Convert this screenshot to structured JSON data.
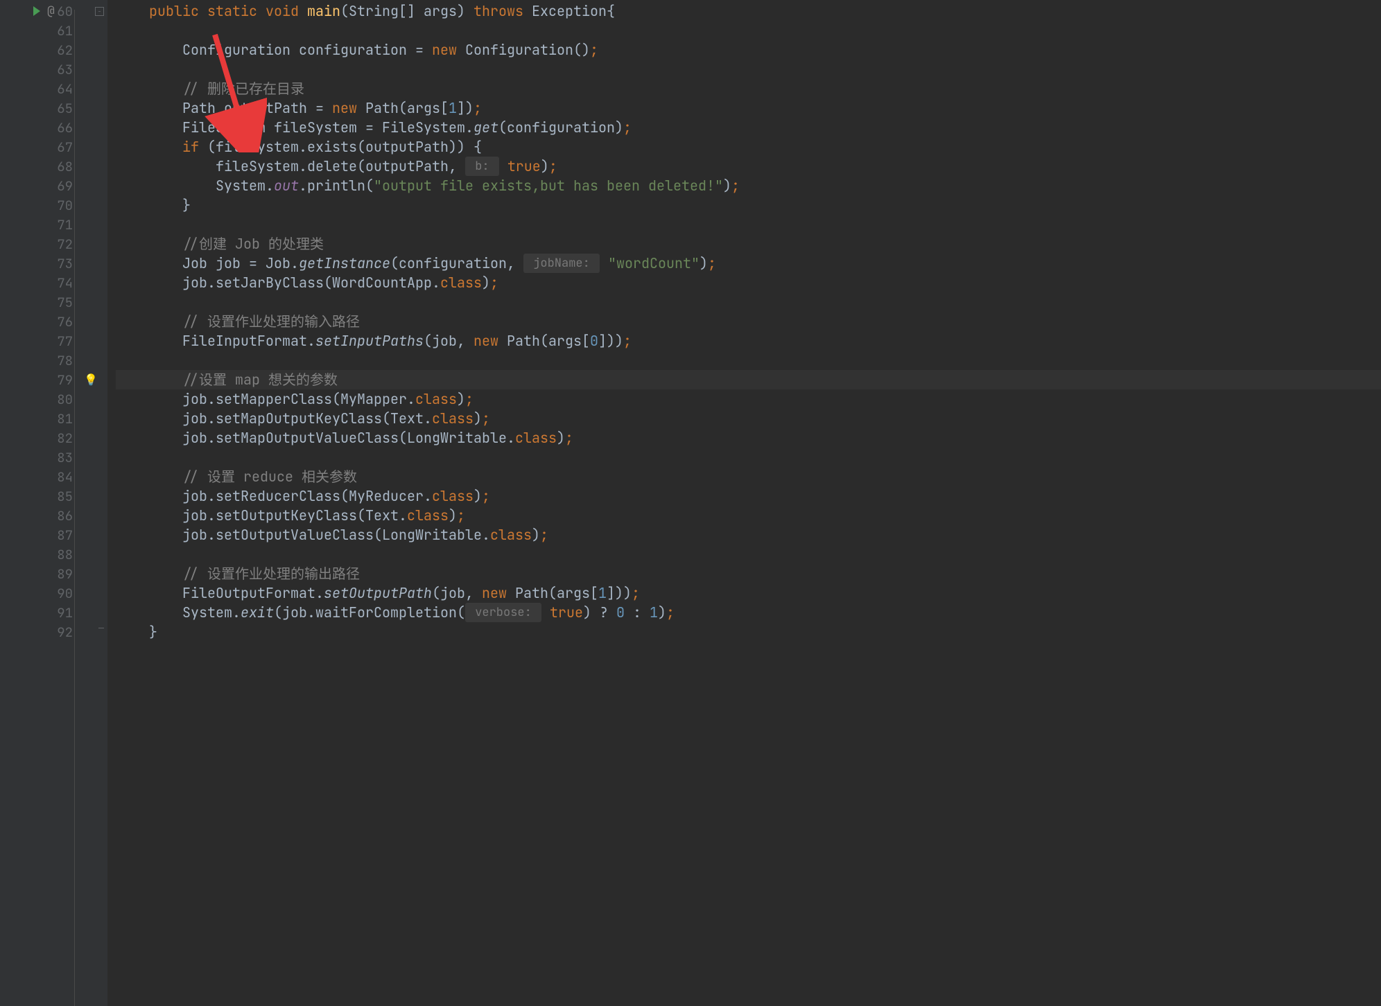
{
  "lineNumbers": [
    60,
    61,
    62,
    63,
    64,
    65,
    66,
    67,
    68,
    69,
    70,
    71,
    72,
    73,
    74,
    75,
    76,
    77,
    78,
    79,
    80,
    81,
    82,
    83,
    84,
    85,
    86,
    87,
    88,
    89,
    90,
    91,
    92
  ],
  "gutterIcons": {
    "runIconLine": 60,
    "overrideSymbol": "@",
    "foldMinusLine60": "−",
    "bulbLine": 79,
    "bulbEmoji": "💡"
  },
  "code": {
    "line60": {
      "indent": "    ",
      "tokens": [
        {
          "t": "public",
          "c": "kw"
        },
        {
          "t": " ",
          "c": "plain"
        },
        {
          "t": "static",
          "c": "kw"
        },
        {
          "t": " ",
          "c": "plain"
        },
        {
          "t": "void",
          "c": "kw"
        },
        {
          "t": " ",
          "c": "plain"
        },
        {
          "t": "main",
          "c": "method-decl"
        },
        {
          "t": "(String[] args) ",
          "c": "plain"
        },
        {
          "t": "throws",
          "c": "kw"
        },
        {
          "t": " Exception{",
          "c": "plain"
        }
      ]
    },
    "line61": {
      "indent": "",
      "tokens": []
    },
    "line62": {
      "indent": "        ",
      "tokens": [
        {
          "t": "Configuration configuration = ",
          "c": "plain"
        },
        {
          "t": "new",
          "c": "kw"
        },
        {
          "t": " Configuration()",
          "c": "plain"
        },
        {
          "t": ";",
          "c": "semicolon"
        }
      ]
    },
    "line63": {
      "indent": "",
      "tokens": []
    },
    "line64": {
      "indent": "        ",
      "tokens": [
        {
          "t": "// 删除已存在目录",
          "c": "comment"
        }
      ]
    },
    "line65": {
      "indent": "        ",
      "tokens": [
        {
          "t": "Path outputPath = ",
          "c": "plain"
        },
        {
          "t": "new",
          "c": "kw"
        },
        {
          "t": " Path(args[",
          "c": "plain"
        },
        {
          "t": "1",
          "c": "num"
        },
        {
          "t": "])",
          "c": "plain"
        },
        {
          "t": ";",
          "c": "semicolon"
        }
      ]
    },
    "line66": {
      "indent": "        ",
      "tokens": [
        {
          "t": "FileSystem fileSystem = FileSystem.",
          "c": "plain"
        },
        {
          "t": "get",
          "c": "static-call"
        },
        {
          "t": "(configuration)",
          "c": "plain"
        },
        {
          "t": ";",
          "c": "semicolon"
        }
      ]
    },
    "line67": {
      "indent": "        ",
      "tokens": [
        {
          "t": "if",
          "c": "kw"
        },
        {
          "t": " (fileSystem.exists(outputPath)) {",
          "c": "plain"
        }
      ]
    },
    "line68": {
      "indent": "            ",
      "tokens": [
        {
          "t": "fileSystem.delete(outputPath, ",
          "c": "plain"
        },
        {
          "t": " b: ",
          "c": "hint"
        },
        {
          "t": " ",
          "c": "plain"
        },
        {
          "t": "true",
          "c": "kw"
        },
        {
          "t": ")",
          "c": "plain"
        },
        {
          "t": ";",
          "c": "semicolon"
        }
      ]
    },
    "line69": {
      "indent": "            ",
      "tokens": [
        {
          "t": "System.",
          "c": "plain"
        },
        {
          "t": "out",
          "c": "field-static"
        },
        {
          "t": ".println(",
          "c": "plain"
        },
        {
          "t": "\"output file exists,but has been deleted!\"",
          "c": "str"
        },
        {
          "t": ")",
          "c": "plain"
        },
        {
          "t": ";",
          "c": "semicolon"
        }
      ]
    },
    "line70": {
      "indent": "        ",
      "tokens": [
        {
          "t": "}",
          "c": "plain"
        }
      ]
    },
    "line71": {
      "indent": "",
      "tokens": []
    },
    "line72": {
      "indent": "        ",
      "tokens": [
        {
          "t": "//创建 Job 的处理类",
          "c": "comment"
        }
      ]
    },
    "line73": {
      "indent": "        ",
      "tokens": [
        {
          "t": "Job job = Job.",
          "c": "plain"
        },
        {
          "t": "getInstance",
          "c": "static-call"
        },
        {
          "t": "(configuration, ",
          "c": "plain"
        },
        {
          "t": " jobName: ",
          "c": "hint"
        },
        {
          "t": " ",
          "c": "plain"
        },
        {
          "t": "\"wordCount\"",
          "c": "str"
        },
        {
          "t": ")",
          "c": "plain"
        },
        {
          "t": ";",
          "c": "semicolon"
        }
      ]
    },
    "line74": {
      "indent": "        ",
      "tokens": [
        {
          "t": "job.setJarByClass(WordCountApp.",
          "c": "plain"
        },
        {
          "t": "class",
          "c": "class-kw"
        },
        {
          "t": ")",
          "c": "plain"
        },
        {
          "t": ";",
          "c": "semicolon"
        }
      ]
    },
    "line75": {
      "indent": "",
      "tokens": []
    },
    "line76": {
      "indent": "        ",
      "tokens": [
        {
          "t": "// 设置作业处理的输入路径",
          "c": "comment"
        }
      ]
    },
    "line77": {
      "indent": "        ",
      "tokens": [
        {
          "t": "FileInputFormat.",
          "c": "plain"
        },
        {
          "t": "setInputPaths",
          "c": "static-call"
        },
        {
          "t": "(job, ",
          "c": "plain"
        },
        {
          "t": "new",
          "c": "kw"
        },
        {
          "t": " Path(args[",
          "c": "plain"
        },
        {
          "t": "0",
          "c": "num"
        },
        {
          "t": "]))",
          "c": "plain"
        },
        {
          "t": ";",
          "c": "semicolon"
        }
      ]
    },
    "line78": {
      "indent": "",
      "tokens": []
    },
    "line79": {
      "indent": "        ",
      "tokens": [
        {
          "t": "//设置 map 想关的参数",
          "c": "comment"
        }
      ]
    },
    "line80": {
      "indent": "        ",
      "tokens": [
        {
          "t": "job.setMapperClass(MyMapper.",
          "c": "plain"
        },
        {
          "t": "class",
          "c": "class-kw"
        },
        {
          "t": ")",
          "c": "plain"
        },
        {
          "t": ";",
          "c": "semicolon"
        }
      ]
    },
    "line81": {
      "indent": "        ",
      "tokens": [
        {
          "t": "job.setMapOutputKeyClass(Text.",
          "c": "plain"
        },
        {
          "t": "class",
          "c": "class-kw"
        },
        {
          "t": ")",
          "c": "plain"
        },
        {
          "t": ";",
          "c": "semicolon"
        }
      ]
    },
    "line82": {
      "indent": "        ",
      "tokens": [
        {
          "t": "job.setMapOutputValueClass(LongWritable.",
          "c": "plain"
        },
        {
          "t": "class",
          "c": "class-kw"
        },
        {
          "t": ")",
          "c": "plain"
        },
        {
          "t": ";",
          "c": "semicolon"
        }
      ]
    },
    "line83": {
      "indent": "",
      "tokens": []
    },
    "line84": {
      "indent": "        ",
      "tokens": [
        {
          "t": "// 设置 reduce 相关参数",
          "c": "comment"
        }
      ]
    },
    "line85": {
      "indent": "        ",
      "tokens": [
        {
          "t": "job.setReducerClass(MyReducer.",
          "c": "plain"
        },
        {
          "t": "class",
          "c": "class-kw"
        },
        {
          "t": ")",
          "c": "plain"
        },
        {
          "t": ";",
          "c": "semicolon"
        }
      ]
    },
    "line86": {
      "indent": "        ",
      "tokens": [
        {
          "t": "job.setOutputKeyClass(Text.",
          "c": "plain"
        },
        {
          "t": "class",
          "c": "class-kw"
        },
        {
          "t": ")",
          "c": "plain"
        },
        {
          "t": ";",
          "c": "semicolon"
        }
      ]
    },
    "line87": {
      "indent": "        ",
      "tokens": [
        {
          "t": "job.setOutputValueClass(LongWritable.",
          "c": "plain"
        },
        {
          "t": "class",
          "c": "class-kw"
        },
        {
          "t": ")",
          "c": "plain"
        },
        {
          "t": ";",
          "c": "semicolon"
        }
      ]
    },
    "line88": {
      "indent": "",
      "tokens": []
    },
    "line89": {
      "indent": "        ",
      "tokens": [
        {
          "t": "// 设置作业处理的输出路径",
          "c": "comment"
        }
      ]
    },
    "line90": {
      "indent": "        ",
      "tokens": [
        {
          "t": "FileOutputFormat.",
          "c": "plain"
        },
        {
          "t": "setOutputPath",
          "c": "static-call"
        },
        {
          "t": "(job, ",
          "c": "plain"
        },
        {
          "t": "new",
          "c": "kw"
        },
        {
          "t": " Path(args[",
          "c": "plain"
        },
        {
          "t": "1",
          "c": "num"
        },
        {
          "t": "]))",
          "c": "plain"
        },
        {
          "t": ";",
          "c": "semicolon"
        }
      ]
    },
    "line91": {
      "indent": "        ",
      "tokens": [
        {
          "t": "System.",
          "c": "plain"
        },
        {
          "t": "exit",
          "c": "static-call"
        },
        {
          "t": "(job.waitForCompletion(",
          "c": "plain"
        },
        {
          "t": " verbose: ",
          "c": "hint"
        },
        {
          "t": " ",
          "c": "plain"
        },
        {
          "t": "true",
          "c": "kw"
        },
        {
          "t": ") ? ",
          "c": "plain"
        },
        {
          "t": "0",
          "c": "num"
        },
        {
          "t": " : ",
          "c": "plain"
        },
        {
          "t": "1",
          "c": "num"
        },
        {
          "t": ")",
          "c": "plain"
        },
        {
          "t": ";",
          "c": "semicolon"
        }
      ]
    },
    "line92": {
      "indent": "    ",
      "tokens": [
        {
          "t": "}",
          "c": "plain"
        }
      ]
    }
  },
  "highlightedLine": 79,
  "arrow": {
    "color": "#e83a3a"
  }
}
